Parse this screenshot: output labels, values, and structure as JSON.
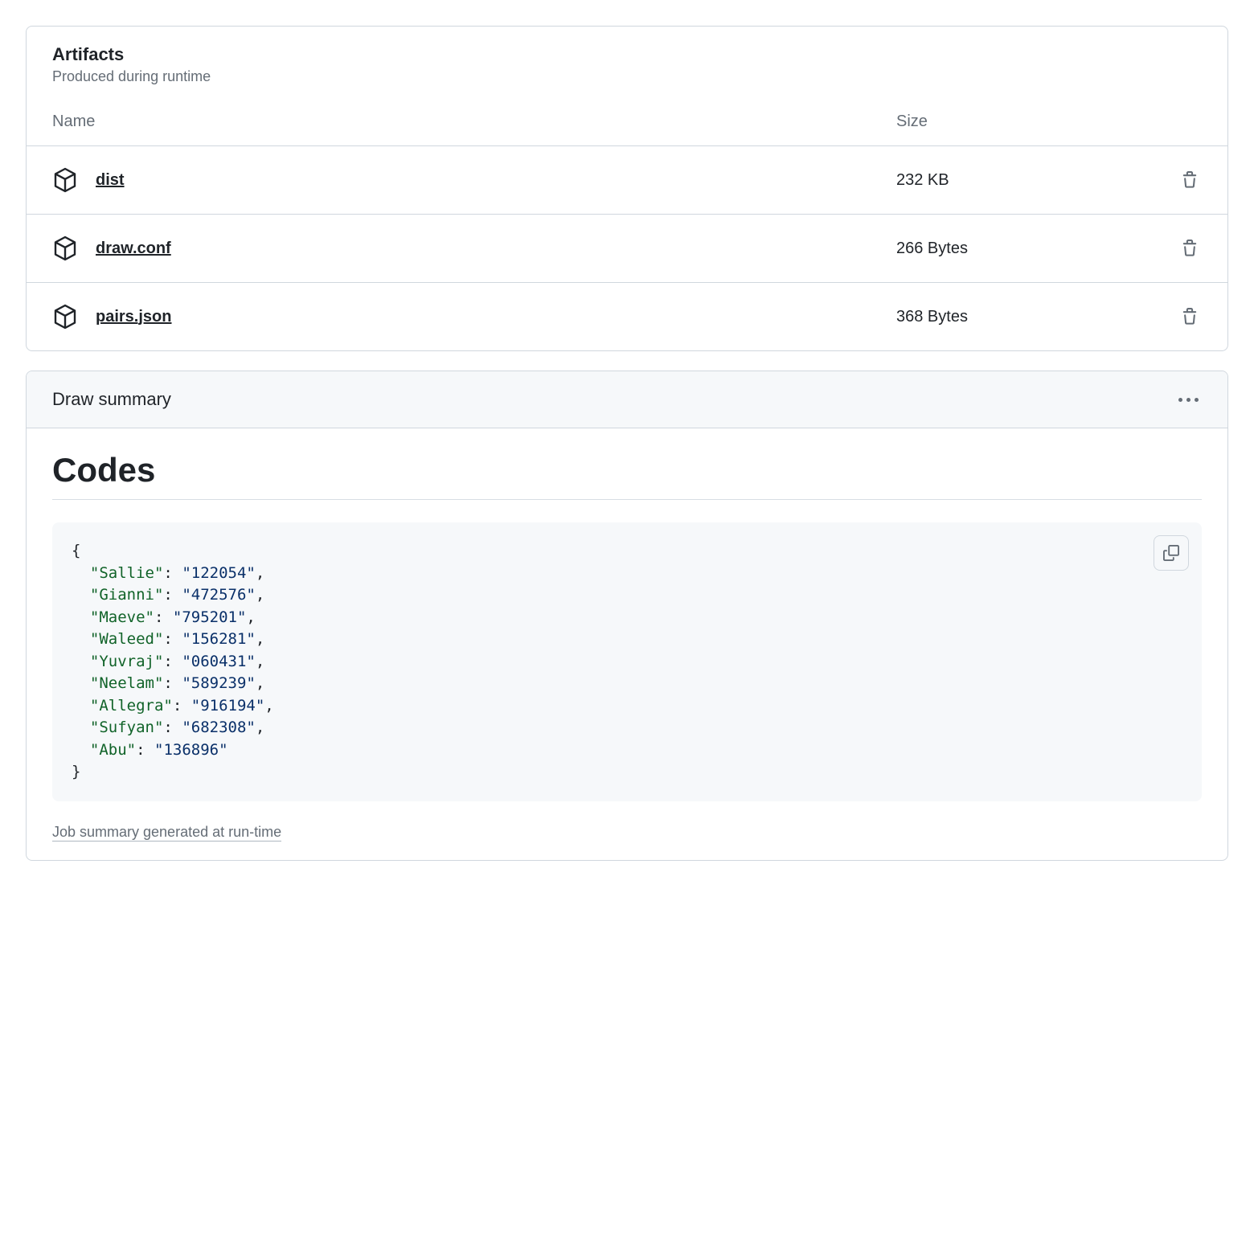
{
  "artifacts": {
    "title": "Artifacts",
    "subtitle": "Produced during runtime",
    "columns": {
      "name": "Name",
      "size": "Size"
    },
    "rows": [
      {
        "name": "dist",
        "size": "232 KB"
      },
      {
        "name": "draw.conf",
        "size": "266 Bytes"
      },
      {
        "name": "pairs.json",
        "size": "368 Bytes"
      }
    ]
  },
  "summary": {
    "title": "Draw summary",
    "heading": "Codes",
    "footer_link": "Job summary generated at run-time",
    "codes": {
      "Sallie": "122054",
      "Gianni": "472576",
      "Maeve": "795201",
      "Waleed": "156281",
      "Yuvraj": "060431",
      "Neelam": "589239",
      "Allegra": "916194",
      "Sufyan": "682308",
      "Abu": "136896"
    }
  }
}
